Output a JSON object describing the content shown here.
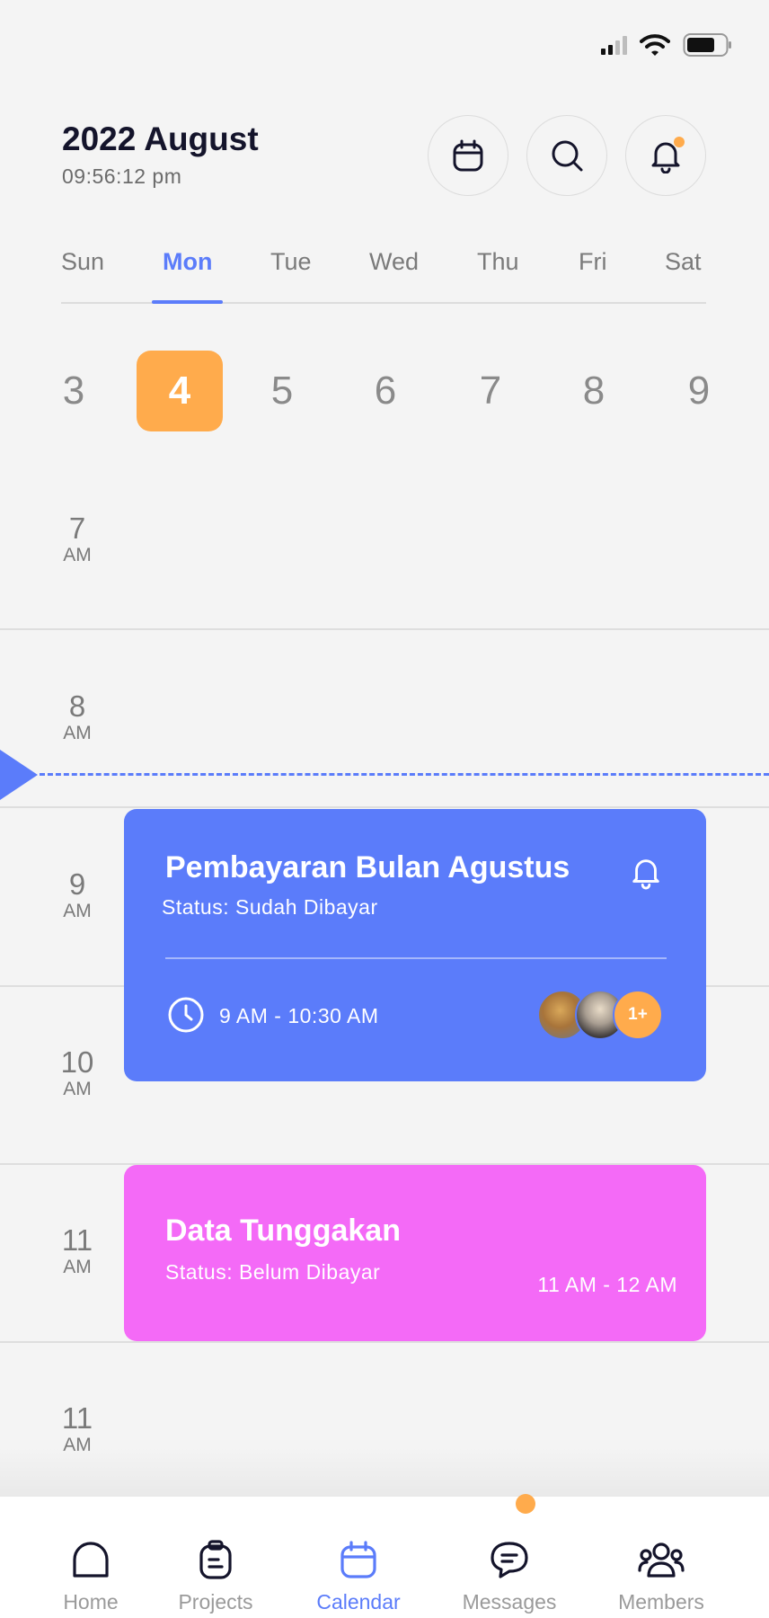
{
  "status_bar": {
    "signal_icon": "signal-icon",
    "wifi_icon": "wifi-icon",
    "battery_icon": "battery-icon"
  },
  "header": {
    "title": "2022 August",
    "time": "09:56:12 pm",
    "buttons": [
      "calendar-icon",
      "search-icon",
      "bell-icon"
    ]
  },
  "week_days": [
    "Sun",
    "Mon",
    "Tue",
    "Wed",
    "Thu",
    "Fri",
    "Sat"
  ],
  "active_day": "Mon",
  "dates": [
    "3",
    "4",
    "5",
    "6",
    "7",
    "8",
    "9"
  ],
  "selected_date": "4",
  "timeline": {
    "slots": [
      {
        "hour": "7",
        "period": "AM"
      },
      {
        "hour": "8",
        "period": "AM"
      },
      {
        "hour": "9",
        "period": "AM"
      },
      {
        "hour": "10",
        "period": "AM"
      },
      {
        "hour": "11",
        "period": "AM"
      },
      {
        "hour": "11",
        "period": "AM"
      }
    ]
  },
  "events": [
    {
      "title": "Pembayaran Bulan Agustus",
      "status": "Status: Sudah Dibayar",
      "time": "9 AM - 10:30 AM",
      "more_attendees": "1+",
      "color": "#5b7cfa"
    },
    {
      "title": "Data Tunggakan",
      "status": "Status: Belum Dibayar",
      "time": "11 AM - 12 AM",
      "color": "#f46af7"
    }
  ],
  "colors": {
    "accent": "#5b7cfa",
    "highlight": "#ffab4c",
    "pink": "#f46af7"
  },
  "nav": [
    {
      "label": "Home",
      "icon": "home-icon"
    },
    {
      "label": "Projects",
      "icon": "clipboard-icon"
    },
    {
      "label": "Calendar",
      "icon": "calendar-icon"
    },
    {
      "label": "Messages",
      "icon": "chat-icon"
    },
    {
      "label": "Members",
      "icon": "members-icon"
    }
  ],
  "active_nav": "Calendar"
}
